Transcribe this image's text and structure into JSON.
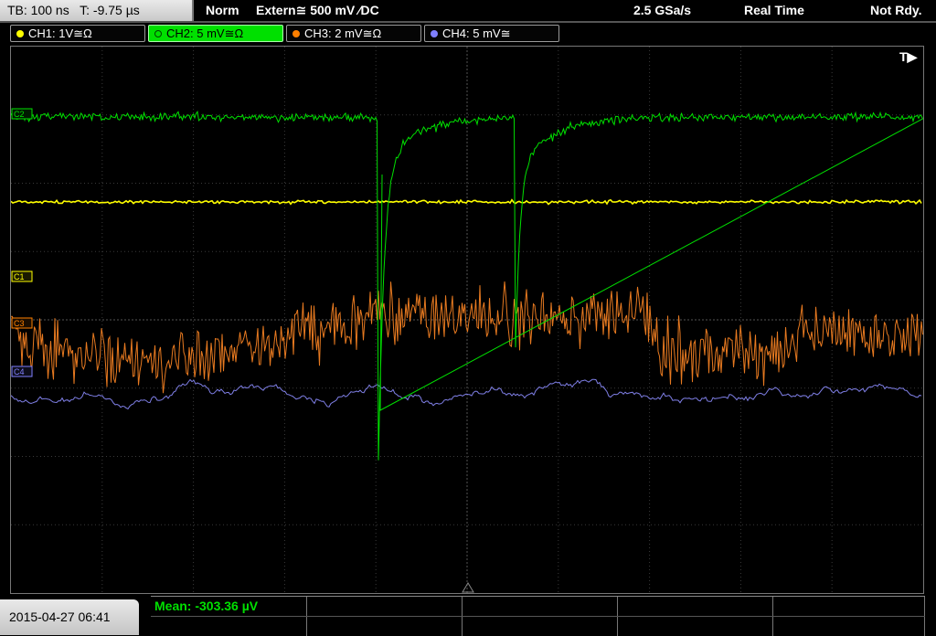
{
  "status": {
    "timebase": "TB: 100 ns",
    "trigger_time": "T: -9.75 µs",
    "trigger_mode": "Norm",
    "trigger_source": "Extern≅ 500 mV ∕DC",
    "sample_rate": "2.5 GSa/s",
    "acq_mode": "Real Time",
    "state": "Not Rdy."
  },
  "channels": [
    {
      "label": "CH1: 1V≅Ω",
      "color": "#ffff00"
    },
    {
      "label": "CH2: 5 mV≅Ω",
      "color": "#00e000"
    },
    {
      "label": "CH3: 2 mV≅Ω",
      "color": "#ff8000"
    },
    {
      "label": "CH4: 5 mV≅",
      "color": "#8080ff"
    }
  ],
  "markers": {
    "trigger": "T▶",
    "c1": "C1",
    "c3": "C3",
    "c4": "C4",
    "c2": "C2"
  },
  "colors": {
    "ch1": "#ffff00",
    "ch2": "#00e000",
    "ch3": "#e87a20",
    "ch4": "#7f7fe6",
    "grid": "#3a3a3a"
  },
  "datetime": "2015-04-27 06:41",
  "measurement": "Mean: -303.36 µV"
}
